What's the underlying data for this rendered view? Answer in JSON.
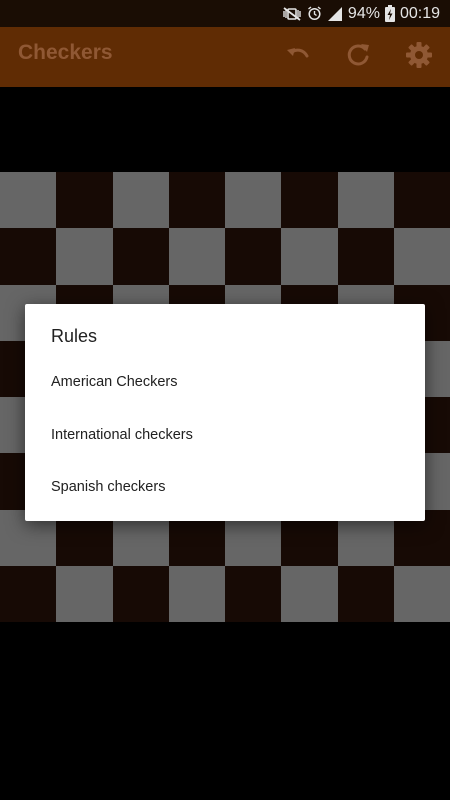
{
  "status_bar": {
    "battery": "94%",
    "time": "00:19",
    "icons": [
      "mute-vibrate-icon",
      "alarm-icon",
      "signal-icon",
      "battery-charging-icon"
    ]
  },
  "app_bar": {
    "title": "Checkers",
    "actions": [
      {
        "name": "undo",
        "icon": "undo-icon"
      },
      {
        "name": "restart",
        "icon": "refresh-icon"
      },
      {
        "name": "settings",
        "icon": "gear-icon"
      }
    ],
    "color": "#6b3105"
  },
  "board": {
    "size": 8,
    "light_color": "#727272",
    "dark_color": "#1a0c06"
  },
  "dialog": {
    "title": "Rules",
    "options": [
      "American Checkers",
      "International checkers",
      "Spanish checkers"
    ]
  }
}
